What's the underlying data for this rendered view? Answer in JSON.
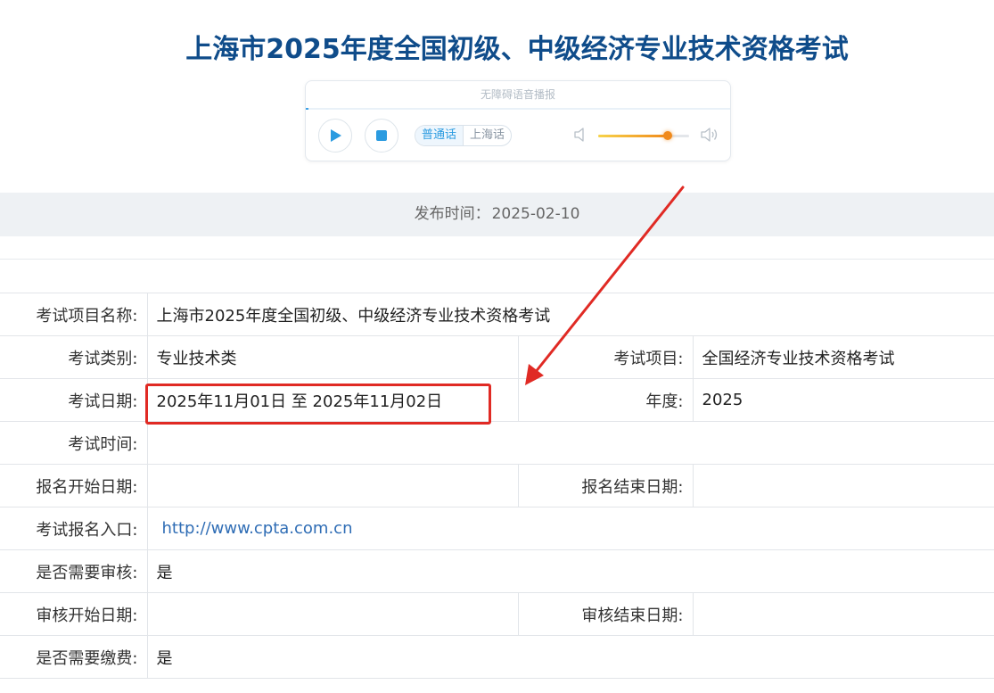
{
  "page": {
    "title": "上海市2025年度全国初级、中级经济专业技术资格考试"
  },
  "player": {
    "caption": "无障碍语音播报",
    "languages": [
      "普通话",
      "上海话"
    ],
    "active_language": "普通话",
    "volume": 0.76,
    "accent_color": "#2b9be0",
    "volume_color": "#f08a1c",
    "icons": [
      "play-icon",
      "stop-icon",
      "volume-low-icon",
      "volume-high-icon"
    ]
  },
  "publish": {
    "label": "发布时间：",
    "date": "2025-02-10"
  },
  "info": {
    "project_name_label": "考试项目名称:",
    "project_name": "上海市2025年度全国初级、中级经济专业技术资格考试",
    "category_label": "考试类别:",
    "category": "专业技术类",
    "project_label": "考试项目:",
    "project": "全国经济专业技术资格考试",
    "exam_date_label": "考试日期:",
    "exam_date": "2025年11月01日 至 2025年11月02日",
    "year_label": "年度:",
    "year": "2025",
    "exam_time_label": "考试时间:",
    "exam_time": "",
    "reg_start_label": "报名开始日期:",
    "reg_start": "",
    "reg_end_label": "报名结束日期:",
    "reg_end": "",
    "reg_entry_label": "考试报名入口:",
    "reg_entry": "http://www.cpta.com.cn",
    "need_review_label": "是否需要审核:",
    "need_review": "是",
    "review_start_label": "审核开始日期:",
    "review_start": "",
    "review_end_label": "审核结束日期:",
    "review_end": "",
    "need_fee_label": "是否需要缴费:",
    "need_fee": "是"
  },
  "annotation": {
    "color": "#e02a24"
  }
}
